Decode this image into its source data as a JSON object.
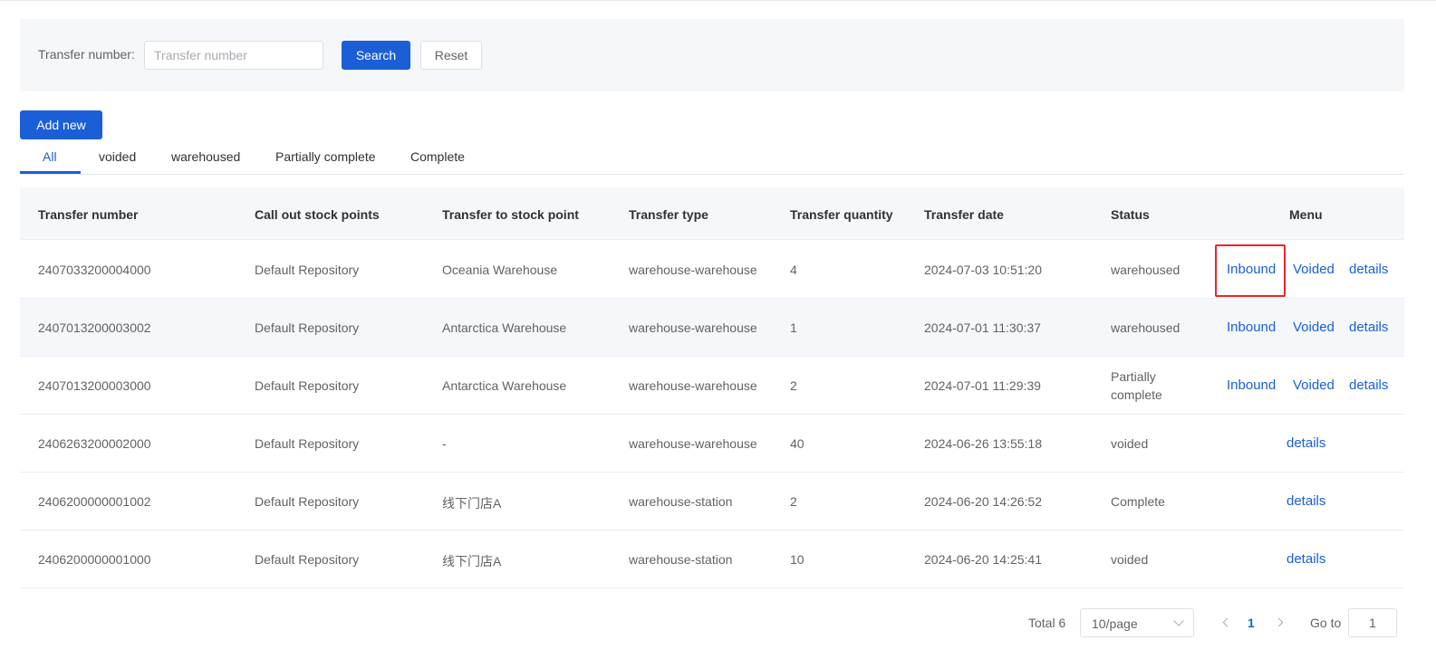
{
  "filter": {
    "label": "Transfer number:",
    "placeholder": "Transfer number",
    "value": "",
    "search_label": "Search",
    "reset_label": "Reset"
  },
  "toolbar": {
    "add_label": "Add new"
  },
  "tabs": [
    {
      "label": "All",
      "active": true
    },
    {
      "label": "voided"
    },
    {
      "label": "warehoused"
    },
    {
      "label": "Partially complete"
    },
    {
      "label": "Complete"
    }
  ],
  "table": {
    "headers": {
      "transfer_number": "Transfer number",
      "call_out": "Call out stock points",
      "transfer_to": "Transfer to stock point",
      "transfer_type": "Transfer type",
      "quantity": "Transfer quantity",
      "date": "Transfer date",
      "status": "Status",
      "menu": "Menu"
    },
    "action_labels": {
      "inbound": "Inbound",
      "voided": "Voided",
      "details": "details"
    },
    "rows": [
      {
        "number": "2407033200004000",
        "call_out": "Default Repository",
        "transfer_to": "Oceania Warehouse",
        "type": "warehouse-warehouse",
        "quantity": "4",
        "date": "2024-07-03 10:51:20",
        "status": "warehoused"
      },
      {
        "number": "2407013200003002",
        "call_out": "Default Repository",
        "transfer_to": "Antarctica Warehouse",
        "type": "warehouse-warehouse",
        "quantity": "1",
        "date": "2024-07-01 11:30:37",
        "status": "warehoused"
      },
      {
        "number": "2407013200003000",
        "call_out": "Default Repository",
        "transfer_to": "Antarctica Warehouse",
        "type": "warehouse-warehouse",
        "quantity": "2",
        "date": "2024-07-01 11:29:39",
        "status": "Partially complete"
      },
      {
        "number": "2406263200002000",
        "call_out": "Default Repository",
        "transfer_to": "-",
        "type": "warehouse-warehouse",
        "quantity": "40",
        "date": "2024-06-26 13:55:18",
        "status": "voided"
      },
      {
        "number": "2406200000001002",
        "call_out": "Default Repository",
        "transfer_to": "线下门店A",
        "type": "warehouse-station",
        "quantity": "2",
        "date": "2024-06-20 14:26:52",
        "status": "Complete"
      },
      {
        "number": "2406200000001000",
        "call_out": "Default Repository",
        "transfer_to": "线下门店A",
        "type": "warehouse-station",
        "quantity": "10",
        "date": "2024-06-20 14:25:41",
        "status": "voided"
      }
    ]
  },
  "pagination": {
    "total": "Total 6",
    "page_size": "10/page",
    "current_page": "1",
    "goto_label": "Go to",
    "goto_value": "1"
  },
  "colors": {
    "primary": "#1a5fd6",
    "highlight": "#e8262b"
  }
}
